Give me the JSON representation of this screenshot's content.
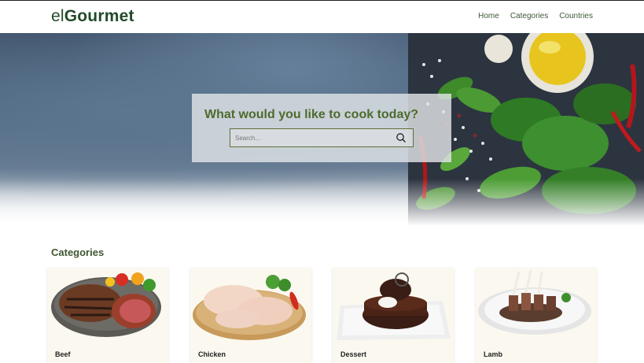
{
  "brand": {
    "prefix": "el",
    "name": "Gourmet"
  },
  "nav": {
    "home": "Home",
    "categories": "Categories",
    "countries": "Countries"
  },
  "hero": {
    "title": "What would you like to cook today?",
    "search_placeholder": "Search..."
  },
  "categories_section": {
    "title": "Categories",
    "items": [
      {
        "label": "Beef"
      },
      {
        "label": "Chicken"
      },
      {
        "label": "Dessert"
      },
      {
        "label": "Lamb"
      }
    ]
  },
  "colors": {
    "brand_green": "#234a2a",
    "accent_green": "#4d6b2c",
    "card_bg": "#fbf8ef"
  }
}
